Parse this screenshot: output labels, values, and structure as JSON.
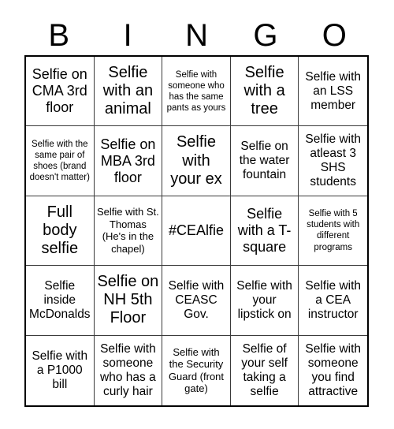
{
  "card": {
    "header_letters": [
      "B",
      "I",
      "N",
      "G",
      "O"
    ],
    "rows": [
      [
        {
          "text": "Selfie on CMA 3rd floor",
          "size": "lg"
        },
        {
          "text": "Selfie with an animal",
          "size": "xl"
        },
        {
          "text": "Selfie with someone who has the same pants as yours",
          "size": "xs"
        },
        {
          "text": "Selfie with a tree",
          "size": "xl"
        },
        {
          "text": "Selfie with an LSS member",
          "size": "md"
        }
      ],
      [
        {
          "text": "Selfie with the same pair of shoes (brand doesn't matter)",
          "size": "xs"
        },
        {
          "text": "Selfie on MBA 3rd floor",
          "size": "lg"
        },
        {
          "text": "Selfie with your ex",
          "size": "xl"
        },
        {
          "text": "Selfie on the water fountain",
          "size": "md"
        },
        {
          "text": "Selfie with atleast 3 SHS students",
          "size": "md"
        }
      ],
      [
        {
          "text": "Full body selfie",
          "size": "xl"
        },
        {
          "text": "Selfie with St. Thomas (He's in the chapel)",
          "size": "sm"
        },
        {
          "text": "#CEAlfie",
          "size": "lg"
        },
        {
          "text": "Selfie with a T-square",
          "size": "lg"
        },
        {
          "text": "Selfie with 5 students with different programs",
          "size": "xs"
        }
      ],
      [
        {
          "text": "Selfie inside McDonalds",
          "size": "md"
        },
        {
          "text": "Selfie on NH 5th Floor",
          "size": "xl"
        },
        {
          "text": "Selfie with CEASC Gov.",
          "size": "md"
        },
        {
          "text": "Selfie with your lipstick on",
          "size": "md"
        },
        {
          "text": "Selfie with a CEA instructor",
          "size": "md"
        }
      ],
      [
        {
          "text": "Selfie with a P1000 bill",
          "size": "md"
        },
        {
          "text": "Selfie with someone who has a curly hair",
          "size": "md"
        },
        {
          "text": "Selfie with the Security Guard (front gate)",
          "size": "sm"
        },
        {
          "text": "Selfie of your self taking a selfie",
          "size": "md"
        },
        {
          "text": "Selfie with someone you find attractive",
          "size": "md"
        }
      ]
    ]
  },
  "colors": {
    "ink": "#000000",
    "grid_line": "#3a3a3a",
    "background": "#ffffff"
  }
}
